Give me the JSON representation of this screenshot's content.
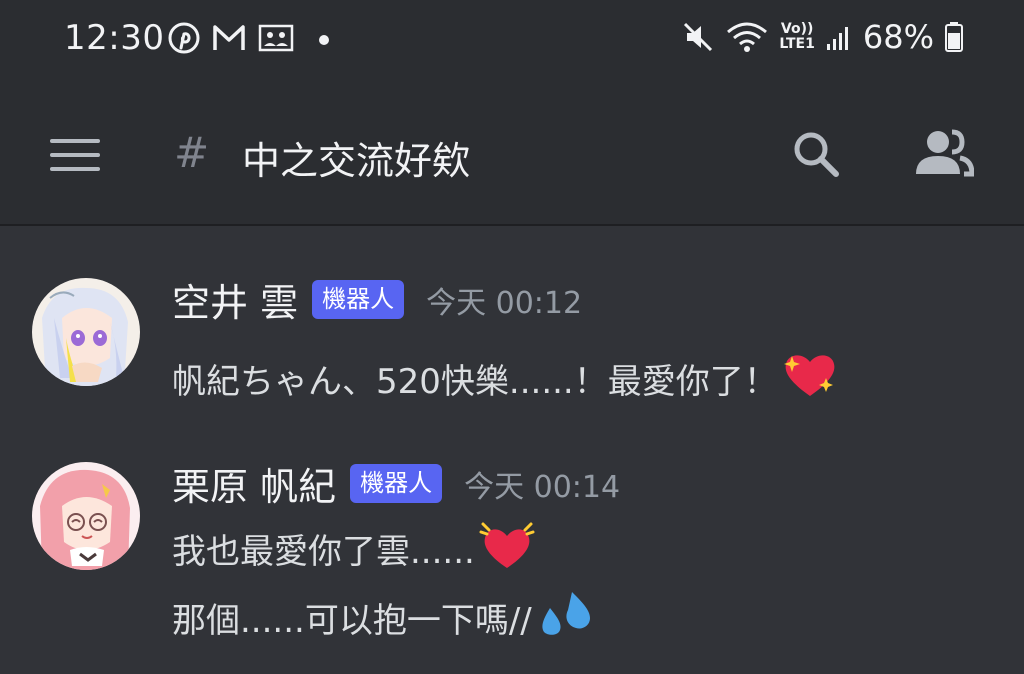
{
  "status_bar": {
    "time": "12:30",
    "left_icons": [
      "pinterest-icon",
      "gmail-icon",
      "gallery-icon",
      "dot-icon"
    ],
    "right_icons": [
      "mute-icon",
      "wifi-icon",
      "volte-icon",
      "signal-icon"
    ],
    "volte_label_top": "Vo))",
    "volte_label_bottom": "LTE1",
    "battery_percent": "68%",
    "battery_level": 0.68
  },
  "header": {
    "channel_prefix": "#",
    "channel_name": "中之交流好欸",
    "icons": [
      "menu-icon",
      "search-icon",
      "members-icon"
    ]
  },
  "messages": [
    {
      "author": "空井 雲",
      "tag": "機器人",
      "timestamp": "今天 00:12",
      "lines": [
        {
          "text": "帆紀ちゃん、520快樂......！最愛你了！",
          "emoji": "sparkling-heart-emoji"
        }
      ]
    },
    {
      "author": "栗原 帆紀",
      "tag": "機器人",
      "timestamp": "今天 00:14",
      "lines": [
        {
          "text": "我也最愛你了雲......",
          "emoji": "beating-heart-emoji"
        },
        {
          "text": "那個......可以抱一下嗎//",
          "emoji": "sweat-droplets-emoji"
        }
      ]
    }
  ],
  "colors": {
    "background": "#313338",
    "header_background": "#2b2d31",
    "bot_tag": "#5865f2",
    "timestamp": "#949ba4",
    "text": "#dbdee1"
  }
}
